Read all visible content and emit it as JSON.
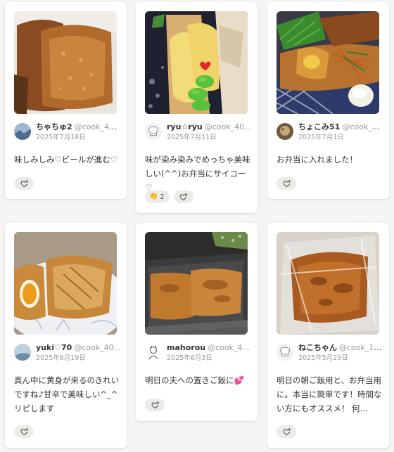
{
  "cards": [
    {
      "user": "ちゃちゅ2",
      "handle": "@cook_404...",
      "date": "2025年7月18日",
      "comment": "味しみしみ♡ビールが進む♡",
      "photo_icon": "photo-fried-tofu",
      "avatar_icon": "avatar-landscape"
    },
    {
      "user": "ryu☆ryu",
      "handle": "@cook_40...",
      "date": "2025年7月11日",
      "comment": "味が染み染みでめっちゃ美味しい(^^)お弁当にサイコー♡",
      "reaction_count": "2",
      "photo_icon": "photo-bento-beans",
      "avatar_icon": "avatar-chef-hat"
    },
    {
      "user": "ちょこみ51",
      "handle": "@cook_40...",
      "date": "2025年7月1日",
      "comment": "お弁当に入れました！",
      "photo_icon": "photo-bento-box",
      "avatar_icon": "avatar-photo"
    },
    {
      "user": "yuki♡70",
      "handle": "@cook_40...",
      "date": "2025年6月19日",
      "comment": "真ん中に黄身が来るのきれいですね♪甘辛で美味しい^_^リピします",
      "photo_icon": "photo-egg-tofu",
      "avatar_icon": "avatar-sky"
    },
    {
      "user": "mahorou",
      "handle": "@cook_4...",
      "date": "2025年6月3日",
      "comment": "明日の夫への置きご飯に💕",
      "photo_icon": "photo-container",
      "avatar_icon": "avatar-sketch"
    },
    {
      "user": "ねこちゃん",
      "handle": "@cook_11...",
      "date": "2025年5月29日",
      "comment": "明日の朝ご飯用と、お弁当用に。本当に簡単です！時間ない方にもオススメ！ 何...",
      "photo_icon": "photo-wrapped",
      "avatar_icon": "avatar-chef-hat"
    }
  ],
  "colors": {
    "card_bg": "#ffffff",
    "page_bg": "#f6f5f3",
    "button_bg": "#ebebe8",
    "muted_text": "#999999"
  },
  "icons": {
    "react_button": "heart-plus-icon",
    "reaction_emoji": "clap-icon"
  }
}
